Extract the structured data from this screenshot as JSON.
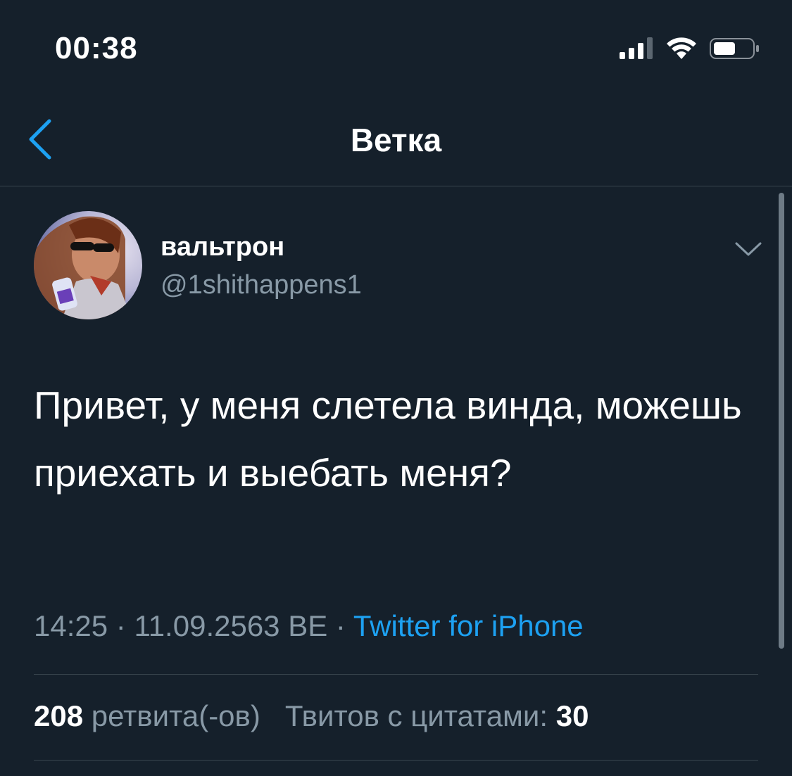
{
  "status_bar": {
    "time": "00:38",
    "icons": [
      "cellular-signal-icon",
      "wifi-icon",
      "battery-icon"
    ]
  },
  "nav": {
    "back_icon": "chevron-left-icon",
    "title": "Ветка"
  },
  "tweet": {
    "display_name": "вальтрон",
    "username": "@1shithappens1",
    "menu_icon": "chevron-down-icon",
    "text": "Привет, у меня слетела винда, можешь приехать и выебать меня?",
    "time": "14:25",
    "separator": "·",
    "date": "11.09.2563 BE",
    "source": "Twitter for iPhone",
    "retweets": {
      "count": "208",
      "label": "ретвита(-ов)"
    },
    "quotes": {
      "label": "Твитов с цитатами:",
      "count": "30"
    }
  },
  "colors": {
    "background": "#15202b",
    "accent": "#1da1f2",
    "secondary_text": "#8899a6",
    "divider": "#38444d"
  }
}
